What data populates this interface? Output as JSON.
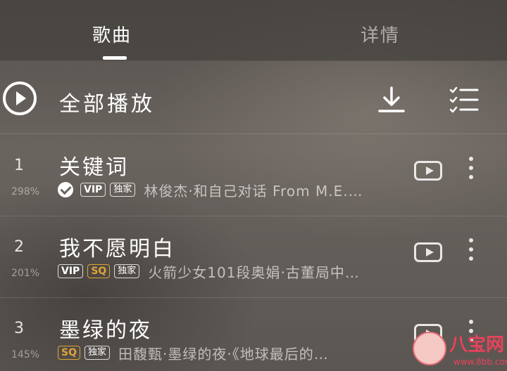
{
  "tabs": {
    "songs_label": "歌曲",
    "details_label": "详情",
    "active": "songs"
  },
  "play_all": {
    "label": "全部播放",
    "icons": [
      "play-circle-icon",
      "download-icon",
      "multi-select-list-icon"
    ]
  },
  "songs": [
    {
      "index": "1",
      "heat": "298%",
      "title": "关键词",
      "downloaded": true,
      "badges": [
        "VIP",
        "独家"
      ],
      "artist": "林俊杰·和自己对话 From M.E.…"
    },
    {
      "index": "2",
      "heat": "201%",
      "title": "我不愿明白",
      "downloaded": false,
      "badges": [
        "VIP",
        "SQ",
        "独家"
      ],
      "artist": "火箭少女101段奥娟·古董局中…"
    },
    {
      "index": "3",
      "heat": "145%",
      "title": "墨绿的夜",
      "downloaded": false,
      "badges": [
        "SQ",
        "独家"
      ],
      "artist": "田馥甄·墨绿的夜·《地球最后的…"
    }
  ],
  "watermark": {
    "name": "八宝网",
    "url": "www.8bb.com"
  },
  "colors": {
    "accent_sq": "#e0a43a",
    "watermark": "#e8425a",
    "text_primary": "#ffffff"
  }
}
